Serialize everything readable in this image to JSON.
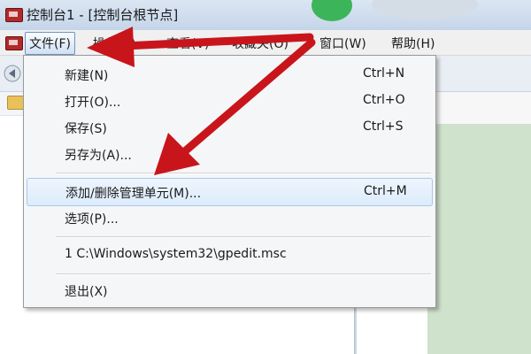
{
  "window": {
    "title": "控制台1 - [控制台根节点]"
  },
  "menubar": {
    "items": [
      {
        "id": "file",
        "label": "文件(F)"
      },
      {
        "id": "action",
        "label": "操作(A)"
      },
      {
        "id": "view",
        "label": "查看(V)"
      },
      {
        "id": "favorites",
        "label": "收藏夹(O)"
      },
      {
        "id": "window",
        "label": "窗口(W)"
      },
      {
        "id": "help",
        "label": "帮助(H)"
      }
    ]
  },
  "file_menu": {
    "items": [
      {
        "label": "新建(N)",
        "shortcut": "Ctrl+N"
      },
      {
        "label": "打开(O)...",
        "shortcut": "Ctrl+O"
      },
      {
        "label": "保存(S)",
        "shortcut": "Ctrl+S"
      },
      {
        "label": "另存为(A)...",
        "shortcut": ""
      },
      {
        "label": "添加/删除管理单元(M)...",
        "shortcut": "Ctrl+M",
        "highlighted": true
      },
      {
        "label": "选项(P)...",
        "shortcut": ""
      },
      {
        "label": "1 C:\\Windows\\system32\\gpedit.msc",
        "shortcut": ""
      },
      {
        "label": "退出(X)",
        "shortcut": ""
      }
    ]
  },
  "icons": [
    "console-app-icon",
    "back-arrow-icon",
    "folder-icon",
    "annotation-arrow"
  ],
  "colors": {
    "annotation_arrow": "#c8151b",
    "menu_highlight": "#dcebfb",
    "title_bar": "#c5d5e9"
  }
}
